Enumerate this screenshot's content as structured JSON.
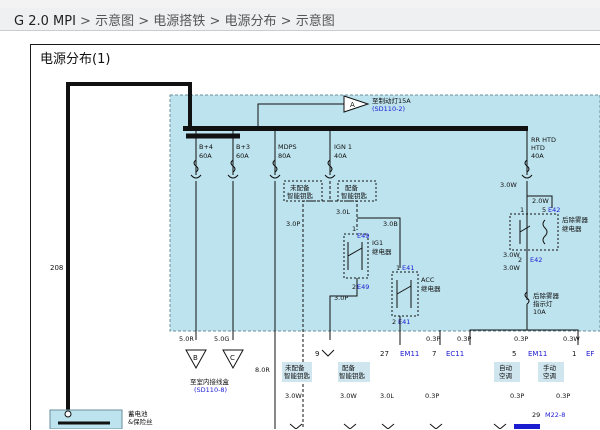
{
  "breadcrumb": {
    "model": "G 2.0 MPI",
    "sep": ">",
    "items": [
      "示意图",
      "电源搭铁",
      "电源分布",
      "示意图"
    ]
  },
  "document": {
    "title": "电源分布(1)"
  },
  "diagram": {
    "top_arrow": {
      "label": "A",
      "text1": "至制动灯15A",
      "ref1": "(SD110-2)"
    },
    "fuses": [
      {
        "name": "B+4",
        "rating": "60A"
      },
      {
        "name": "B+3",
        "rating": "60A"
      },
      {
        "name": "MDPS",
        "rating": "80A"
      },
      {
        "name": "IGN 1",
        "rating": "40A"
      },
      {
        "name": "RR HTD",
        "rating": "40A"
      }
    ],
    "dashed_boxes": {
      "a": "未配备\n智能钥匙",
      "b": "配备\n智能钥匙"
    },
    "relays": {
      "ig1": "IG1\n继电器",
      "acc": "ACC\n继电器",
      "rear_defog": "后除雾器\n继电器",
      "rear_defog_fuse": "后除雾器\n指示灯\n10A"
    },
    "wires": {
      "w208": "208",
      "w30P": "3.0P",
      "w30L_1": "3.0L",
      "w30B": "3.0B",
      "w30L_2": "3.0L",
      "w30P_2": "3.0P",
      "w30W_1": "3.0W",
      "w20W": "2.0W",
      "w30W_2": "3.0W",
      "w30W_3": "3.0W",
      "w50R": "5.0R",
      "w50G": "5.0G",
      "w80R": "8.0R",
      "w30W_4": "3.0W",
      "w30W_5": "3.0W",
      "w30L_3": "3.0L",
      "w03P_1": "0.3P",
      "w03P_2": "0.3P",
      "w03P_3": "0.3P",
      "w03W": "0.3W",
      "w03P_4": "0.3P"
    },
    "connectors": {
      "E49a": "E49",
      "E49b": "E49",
      "E41a": "E41",
      "E41b": "E41",
      "E42a": "E42",
      "E42b": "E42",
      "EM11a": "EM11",
      "EC11": "EC11",
      "EM11b": "EM11",
      "EF": "EF",
      "M22": "M22-8"
    },
    "pins": {
      "p1a": "1",
      "p3a": "3",
      "p2a": "2",
      "p4a": "4",
      "p1b": "1",
      "p3b": "3",
      "p2b": "2",
      "p4b": "4",
      "p1c": "1",
      "p5c": "5",
      "p3c": "3",
      "p2c": "2",
      "p9": "9",
      "p27": "27",
      "p7": "7",
      "p5d": "5",
      "p1d": "1",
      "p29": "29"
    },
    "terminals": {
      "B": "B",
      "C": "C",
      "bottom_ref": "至室内接线盒",
      "bottom_ref2": "(SD110-8)"
    },
    "lower_labels": {
      "noSmart": "未配备\n智能钥匙",
      "smart": "配备\n智能钥匙",
      "autoAC": "自动\n空调",
      "manualAC": "手动\n空调",
      "battery": "蓄电池\n&保险丝"
    }
  }
}
